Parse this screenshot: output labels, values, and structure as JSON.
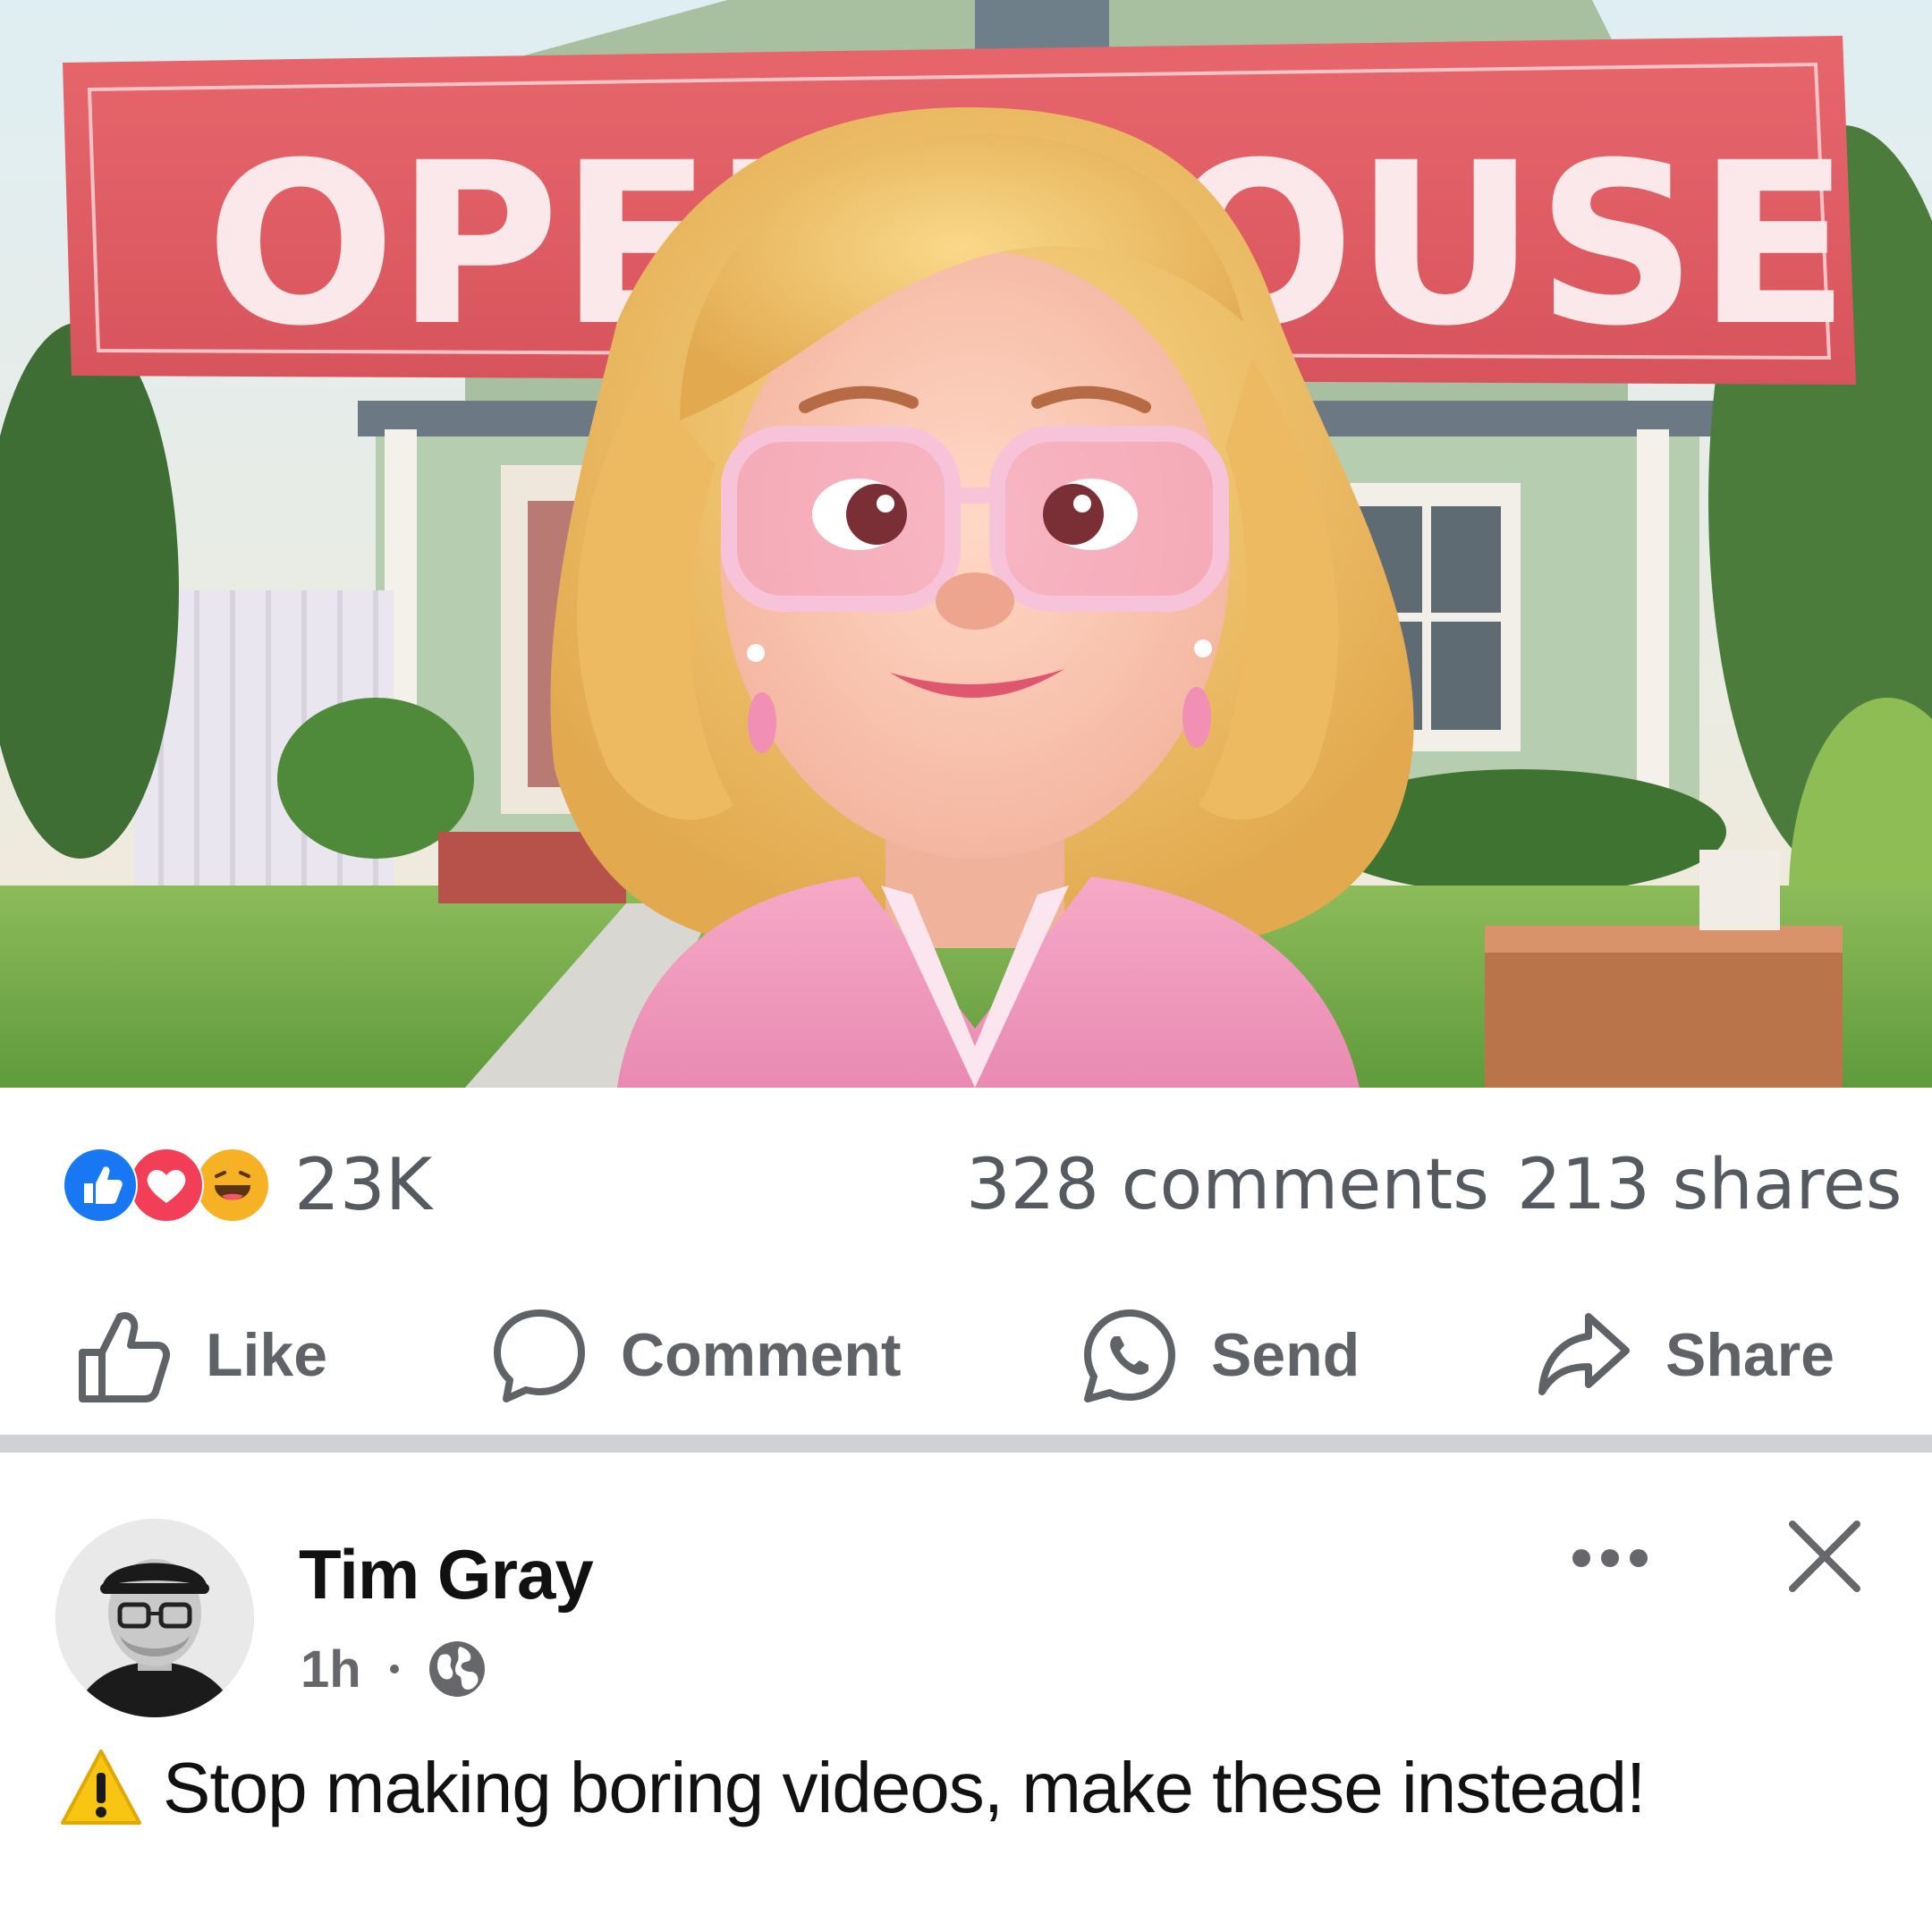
{
  "hero": {
    "banner_text": "OPEN HOUSE"
  },
  "reactions": {
    "icons": [
      "like-reaction-icon",
      "love-reaction-icon",
      "haha-reaction-icon"
    ],
    "count": "23K",
    "comments": "328 comments",
    "shares": "213 shares"
  },
  "actions": {
    "like": "Like",
    "comment": "Comment",
    "send": "Send",
    "share": "Share"
  },
  "next_post": {
    "author": "Tim Gray",
    "time": "1h",
    "audience_icon": "globe-icon",
    "caption_icon": "warning-icon",
    "caption": "Stop making boring videos, make these instead!"
  },
  "colors": {
    "like_blue": "#1877f2",
    "love_red": "#f33e58",
    "haha_yellow": "#f7b125",
    "muted_text": "#65676b",
    "divider": "#cfd1d4"
  }
}
